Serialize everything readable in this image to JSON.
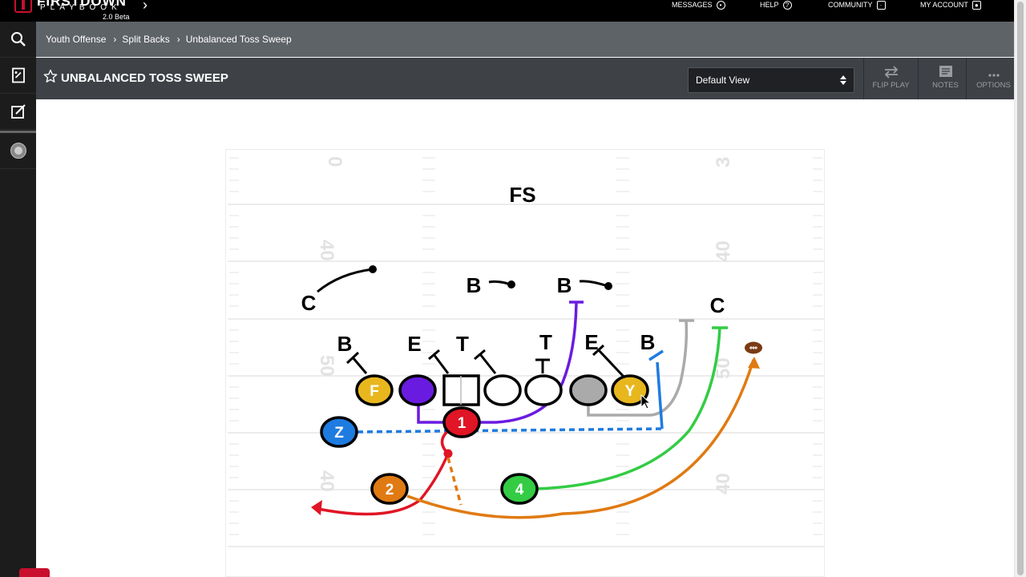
{
  "brand": {
    "word1": "FIRSTDOWN",
    "word2": "PLAYBOOK",
    "version": "2.0 Beta"
  },
  "topnav": [
    {
      "label": "MESSAGES",
      "icon": "bell-icon"
    },
    {
      "label": "HELP",
      "icon": "help-circle-icon"
    },
    {
      "label": "COMMUNITY",
      "icon": "chat-bubble-icon"
    },
    {
      "label": "MY ACCOUNT",
      "icon": "account-icon"
    }
  ],
  "sidebar": [
    {
      "icon": "search-icon"
    },
    {
      "icon": "playbook-icon"
    },
    {
      "icon": "edit-icon"
    },
    {
      "icon": "team-logo-icon"
    }
  ],
  "breadcrumb": [
    "Youth Offense",
    "Split Backs",
    "Unbalanced Toss Sweep"
  ],
  "play": {
    "title": "UNBALANCED TOSS SWEEP",
    "view_select": "Default View"
  },
  "toolbar": {
    "flip_label": "FLIP PLAY",
    "notes_label": "NOTES",
    "options_label": "OPTIONS"
  },
  "field": {
    "yard_numbers": [
      "0",
      "3",
      "40",
      "40",
      "50",
      "50",
      "40",
      "40"
    ],
    "defense_labels": {
      "fs": "FS",
      "c_left": "C",
      "c_right": "C",
      "b_mid1": "B",
      "b_mid2": "B",
      "b_left": "B",
      "e_left": "E",
      "t_left": "T",
      "t_right": "T",
      "e_right": "E",
      "b_right": "B"
    },
    "offense_labels": {
      "f": "F",
      "y": "Y",
      "z": "Z",
      "qb": "1",
      "rb2": "2",
      "rb4": "4"
    },
    "colors": {
      "yellow": "#E8B71E",
      "purple": "#6A1BE0",
      "gray": "#AAAAAA",
      "blue": "#1E7BE0",
      "red": "#E01525",
      "orange": "#E07A12",
      "green": "#33CC44",
      "ball": "#7A3B14"
    }
  }
}
